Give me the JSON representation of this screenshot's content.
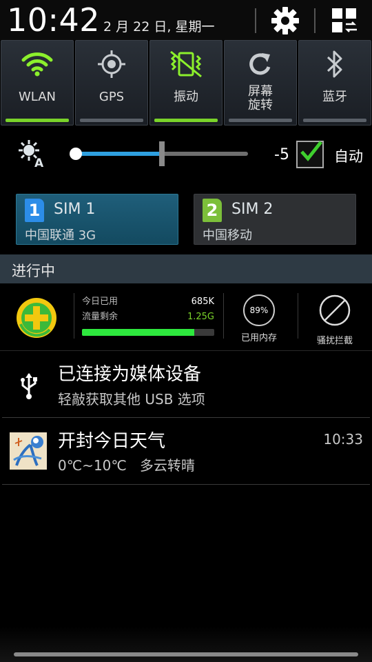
{
  "header": {
    "time": "10:42",
    "date": "2 月 22 日, 星期一"
  },
  "toggles": [
    {
      "label": "WLAN",
      "icon": "wifi-icon",
      "on": true
    },
    {
      "label": "GPS",
      "icon": "gps-icon",
      "on": false
    },
    {
      "label": "振动",
      "icon": "vibrate-icon",
      "on": true
    },
    {
      "label_line1": "屏幕",
      "label_line2": "旋转",
      "icon": "rotate-icon",
      "on": false
    },
    {
      "label": "蓝牙",
      "icon": "bluetooth-icon",
      "on": false
    }
  ],
  "brightness": {
    "value": "-5",
    "auto_label": "自动",
    "auto_checked": true,
    "level": 0.5
  },
  "sims": [
    {
      "number": "1",
      "name": "SIM 1",
      "carrier": "中国联通 3G",
      "active": true
    },
    {
      "number": "2",
      "name": "SIM 2",
      "carrier": "中国移动",
      "active": false
    }
  ],
  "section": {
    "ongoing_label": "进行中"
  },
  "widget360": {
    "today_used_label": "今日已用",
    "today_used_value": "685K",
    "remaining_label": "流量剩余",
    "remaining_value": "1.25G",
    "remaining_fraction": 0.85,
    "memory_percent": "89%",
    "memory_label": "已用内存",
    "block_label": "骚扰拦截"
  },
  "notifications": {
    "usb": {
      "title": "已连接为媒体设备",
      "subtitle": "轻敲获取其他 USB 选项"
    },
    "weather": {
      "title": "开封今日天气",
      "subtitle": "0℃~10℃   多云转晴",
      "time": "10:33"
    }
  },
  "colors": {
    "accent_green": "#7ad32a",
    "slider_blue": "#2fa0e0",
    "sim1_bg": "#1f5e7a"
  }
}
